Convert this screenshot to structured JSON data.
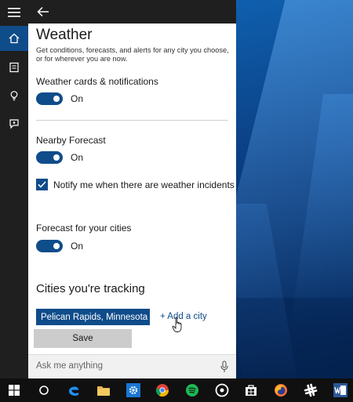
{
  "header": {
    "back_icon": "back-arrow-icon"
  },
  "rail": {
    "items": [
      {
        "icon": "hamburger-menu-icon",
        "active": false
      },
      {
        "icon": "home-icon",
        "active": true
      },
      {
        "icon": "notebook-icon",
        "active": false
      },
      {
        "icon": "lightbulb-icon",
        "active": false
      },
      {
        "icon": "feedback-icon",
        "active": false
      }
    ]
  },
  "settings": {
    "title": "Weather",
    "description": "Get conditions, forecasts, and alerts for any city you choose, or for wherever you are now.",
    "weather_cards": {
      "label": "Weather cards & notifications",
      "state": "On"
    },
    "nearby": {
      "label": "Nearby Forecast",
      "state": "On"
    },
    "notify": {
      "label": "Notify me when there are weather incidents",
      "checked": true
    },
    "forecast": {
      "label": "Forecast for your cities",
      "state": "On"
    },
    "cities": {
      "title": "Cities you're tracking",
      "items": [
        "Pelican Rapids, Minnesota"
      ],
      "add_label": "+ Add a city"
    },
    "save_label": "Save"
  },
  "search": {
    "placeholder": "Ask me anything",
    "mic_icon": "microphone-icon"
  },
  "colors": {
    "accent": "#0f4c8a",
    "rail_bg": "#1f1f1f",
    "panel_bg": "#ffffff",
    "taskbar_bg": "#101010"
  },
  "taskbar": {
    "icons": [
      "windows-start-icon",
      "cortana-icon",
      "edge-icon",
      "file-explorer-icon",
      "settings-gear-icon",
      "chrome-icon",
      "spotify-icon",
      "groove-music-icon",
      "store-icon",
      "firefox-icon",
      "slack-icon",
      "word-icon"
    ]
  }
}
